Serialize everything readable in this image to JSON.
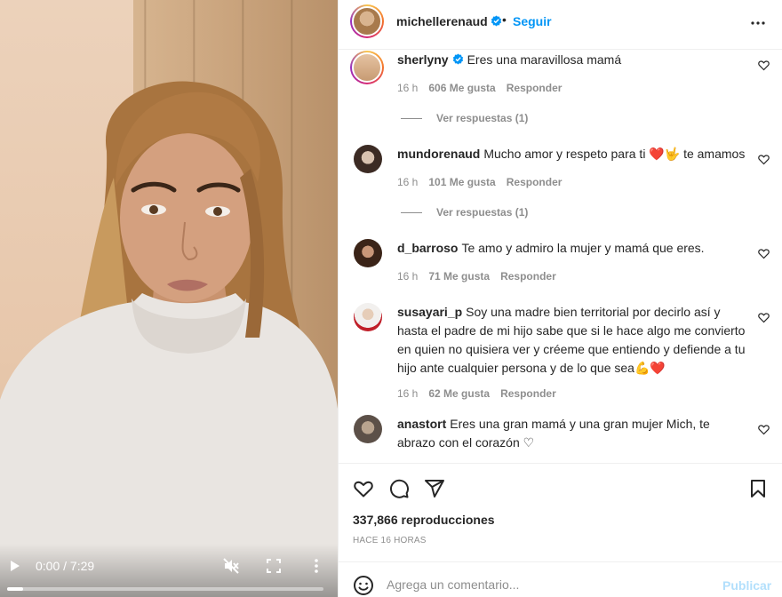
{
  "post": {
    "author": "michellerenaud",
    "follow_label": "Seguir",
    "dot": "•",
    "views": "337,866 reproducciones",
    "posted_ago": "HACE 16 HORAS"
  },
  "video": {
    "time": "0:00 / 7:29",
    "progress_fraction": 0.05
  },
  "comments": [
    {
      "user": "sherlyny",
      "verified": true,
      "text": "Eres una maravillosa mamá",
      "age": "16 h",
      "likes": "606 Me gusta",
      "reply_label": "Responder",
      "view_replies": "Ver respuestas (1)"
    },
    {
      "user": "mundorenaud",
      "verified": false,
      "text": "Mucho amor y respeto para ti ❤️🤟 te amamos",
      "age": "16 h",
      "likes": "101 Me gusta",
      "reply_label": "Responder",
      "view_replies": "Ver respuestas (1)"
    },
    {
      "user": "d_barroso",
      "verified": false,
      "text": "Te amo y admiro la mujer y mamá que eres.",
      "age": "16 h",
      "likes": "71 Me gusta",
      "reply_label": "Responder"
    },
    {
      "user": "susayari_p",
      "verified": false,
      "text": "Soy una madre bien territorial por decirlo así y hasta el padre de mi hijo sabe que si le hace algo me convierto en quien no quisiera ver y créeme que entiendo y defiende a tu hijo ante cualquier persona y de lo que sea💪❤️",
      "age": "16 h",
      "likes": "62 Me gusta",
      "reply_label": "Responder"
    },
    {
      "user": "anastort",
      "verified": false,
      "text": "Eres una gran mamá y una gran mujer Mich, te abrazo con el corazón ♡"
    }
  ],
  "composer": {
    "placeholder": "Agrega un comentario...",
    "publish_label": "Publicar"
  },
  "icons": {
    "verified": "verified-badge-icon",
    "like": "heart-icon",
    "comment": "comment-icon",
    "share": "share-icon",
    "save": "bookmark-icon",
    "emoji": "emoji-icon",
    "more": "more-icon",
    "play": "play-icon",
    "mute": "mute-icon",
    "fullscreen": "fullscreen-icon"
  },
  "colors": {
    "accent": "#0095f6",
    "publish_disabled": "#b2dffc",
    "muted_text": "#8e8e8e",
    "heart": "#e0245e"
  }
}
